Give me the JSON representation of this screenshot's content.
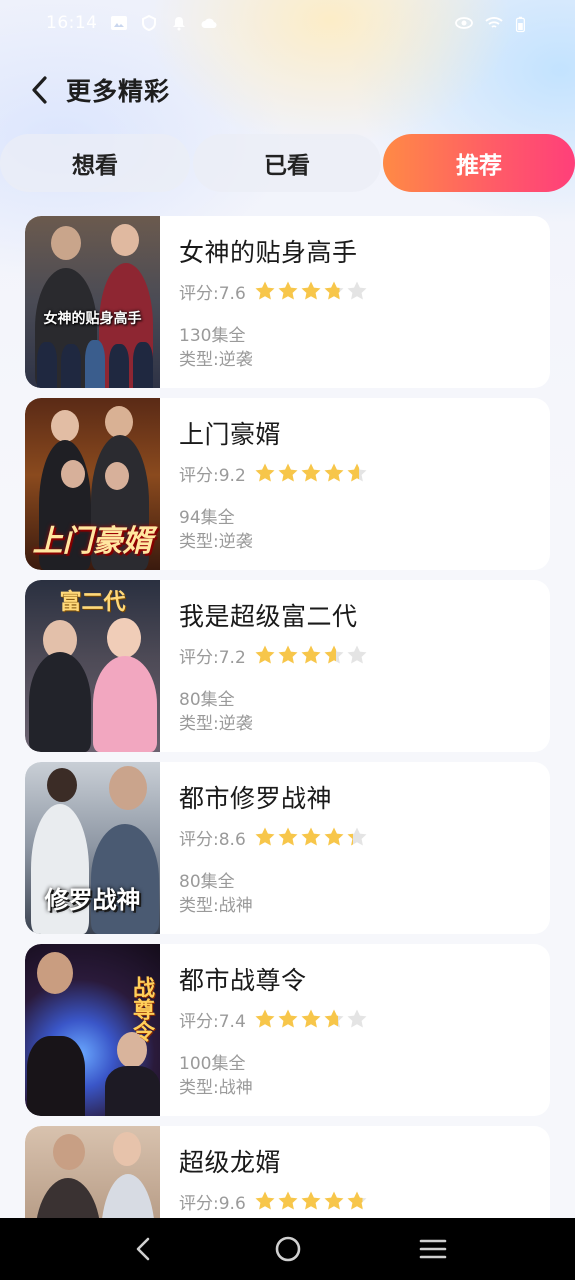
{
  "status_bar": {
    "time": "16:14",
    "icons": [
      "image-icon",
      "shield-icon",
      "notification-icon",
      "cloud-icon",
      "eye-icon",
      "wifi-icon",
      "battery-icon"
    ]
  },
  "header": {
    "title": "更多精彩"
  },
  "tabs": [
    {
      "label": "想看",
      "active": false
    },
    {
      "label": "已看",
      "active": false
    },
    {
      "label": "推荐",
      "active": true
    }
  ],
  "list": [
    {
      "title": "女神的贴身高手",
      "rating": "评分:7.6",
      "stars": 3.8,
      "episodes": "130集全",
      "genre": "类型:逆袭",
      "poster_caption": "女神的贴身高手"
    },
    {
      "title": "上门豪婿",
      "rating": "评分:9.2",
      "stars": 4.6,
      "episodes": "94集全",
      "genre": "类型:逆袭",
      "poster_caption": "上门豪婿"
    },
    {
      "title": "我是超级富二代",
      "rating": "评分:7.2",
      "stars": 3.6,
      "episodes": "80集全",
      "genre": "类型:逆袭",
      "poster_caption": "富二代"
    },
    {
      "title": "都市修罗战神",
      "rating": "评分:8.6",
      "stars": 4.3,
      "episodes": "80集全",
      "genre": "类型:战神",
      "poster_caption": "修罗战神"
    },
    {
      "title": "都市战尊令",
      "rating": "评分:7.4",
      "stars": 3.7,
      "episodes": "100集全",
      "genre": "类型:战神",
      "poster_caption": "战尊令"
    },
    {
      "title": "超级龙婿",
      "rating": "评分:9.6",
      "stars": 4.8,
      "episodes": "",
      "genre": "",
      "poster_caption": ""
    }
  ],
  "colors": {
    "accent_start": "#ff8a45",
    "accent_end": "#ff3f7a",
    "star_filled": "#f7c64a",
    "star_empty": "#e4e4e4"
  }
}
